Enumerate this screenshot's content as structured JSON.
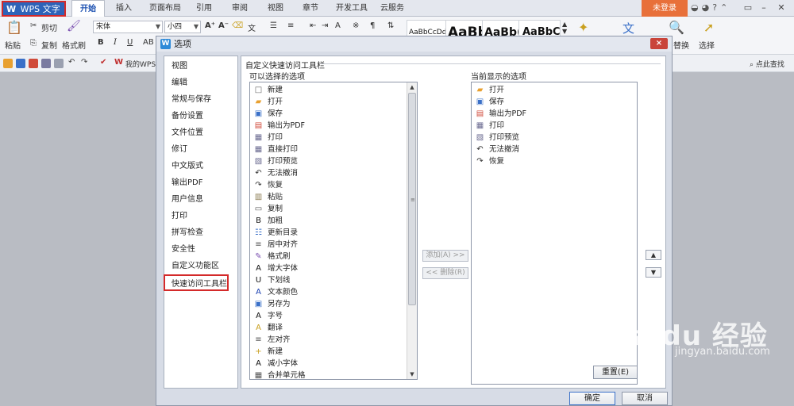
{
  "app": {
    "menu_label": "WPS 文字",
    "logo": "W"
  },
  "tabs": [
    "开始",
    "插入",
    "页面布局",
    "引用",
    "审阅",
    "视图",
    "章节",
    "开发工具",
    "云服务"
  ],
  "account": {
    "login_label": "未登录"
  },
  "ribbon": {
    "paste": "粘贴",
    "cut": "剪切",
    "copy": "复制",
    "format_painter": "格式刷",
    "font_name": "宋体",
    "font_size": "小四",
    "bold": "B",
    "italic": "I",
    "underline": "U",
    "styles": [
      "AaBbCcDd",
      "AaBb",
      "AaBb(",
      "AaBbC"
    ],
    "replace": "替换",
    "select": "选择",
    "search_placeholder": "点此查找"
  },
  "quickbar": {
    "mywps": "我的WPS"
  },
  "dialog": {
    "title": "选项",
    "close": "×",
    "nav": [
      "视图",
      "编辑",
      "常规与保存",
      "备份设置",
      "文件位置",
      "修订",
      "中文版式",
      "输出PDF",
      "用户信息",
      "打印",
      "拼写检查",
      "安全性",
      "自定义功能区",
      "快速访问工具栏"
    ],
    "active_nav": "快速访问工具栏",
    "group_title": "自定义快速访问工具栏",
    "available_label": "可以选择的选项",
    "current_label": "当前显示的选项",
    "available": [
      {
        "icon": "new-doc-icon",
        "label": "新建"
      },
      {
        "icon": "open-folder-icon",
        "label": "打开"
      },
      {
        "icon": "save-icon",
        "label": "保存"
      },
      {
        "icon": "export-pdf-icon",
        "label": "输出为PDF"
      },
      {
        "icon": "print-icon",
        "label": "打印"
      },
      {
        "icon": "direct-print-icon",
        "label": "直接打印"
      },
      {
        "icon": "print-preview-icon",
        "label": "打印预览"
      },
      {
        "icon": "undo-icon",
        "label": "无法撤消"
      },
      {
        "icon": "redo-icon",
        "label": "恢复"
      },
      {
        "icon": "paste-icon",
        "label": "粘贴"
      },
      {
        "icon": "copy-icon",
        "label": "复制"
      },
      {
        "icon": "bold-icon",
        "label": "加粗"
      },
      {
        "icon": "update-toc-icon",
        "label": "更新目录"
      },
      {
        "icon": "align-center-icon",
        "label": "居中对齐"
      },
      {
        "icon": "format-painter-icon",
        "label": "格式刷"
      },
      {
        "icon": "grow-font-icon",
        "label": "增大字体"
      },
      {
        "icon": "underline-icon",
        "label": "下划线"
      },
      {
        "icon": "text-color-icon",
        "label": "文本颜色"
      },
      {
        "icon": "save-as-icon",
        "label": "另存为"
      },
      {
        "icon": "font-size-icon",
        "label": "字号"
      },
      {
        "icon": "translate-icon",
        "label": "翻译"
      },
      {
        "icon": "align-left-icon",
        "label": "左对齐"
      },
      {
        "icon": "new-icon",
        "label": "新建"
      },
      {
        "icon": "shrink-font-icon",
        "label": "减小字体"
      },
      {
        "icon": "merge-cells-icon",
        "label": "合并单元格"
      }
    ],
    "current": [
      {
        "icon": "open-folder-icon",
        "label": "打开"
      },
      {
        "icon": "save-icon",
        "label": "保存"
      },
      {
        "icon": "export-pdf-icon",
        "label": "输出为PDF"
      },
      {
        "icon": "print-icon",
        "label": "打印"
      },
      {
        "icon": "print-preview-icon",
        "label": "打印预览"
      },
      {
        "icon": "undo-icon",
        "label": "无法撤消"
      },
      {
        "icon": "redo-icon",
        "label": "恢复"
      }
    ],
    "add_button": "添加(A) >>",
    "remove_button": "<< 删除(R)",
    "reset_button": "重置(E)",
    "ok_button": "确定",
    "cancel_button": "取消"
  },
  "watermark": {
    "brand": "Bai du 经验",
    "url": "jingyan.baidu.com"
  }
}
